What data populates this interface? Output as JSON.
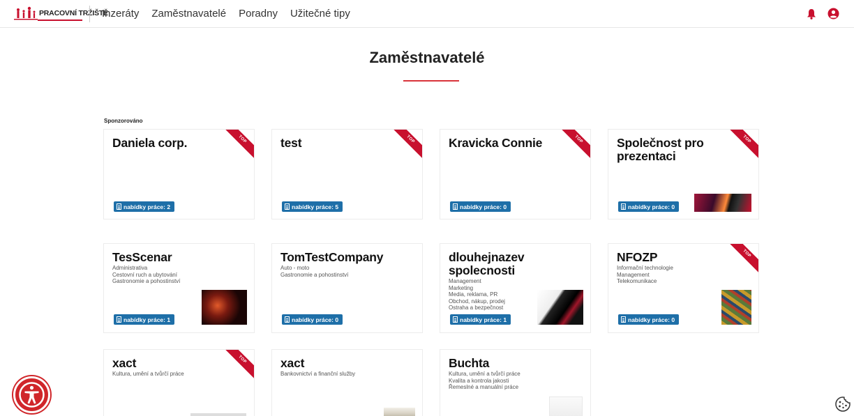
{
  "header": {
    "logo_text": "PRACOVNÍ TRŽIŠTĚ",
    "nav": [
      "Inzeráty",
      "Zaměstnavatelé",
      "Poradny",
      "Užitečné tipy"
    ],
    "icons": [
      "bell-icon",
      "user-circle-icon"
    ],
    "accent_color": "#c8102e"
  },
  "page": {
    "title": "Zaměstnavatelé",
    "sponsored_label": "Sponzorováno"
  },
  "cards": [
    {
      "name": "Daniela corp.",
      "categories": [],
      "jobs": "nabídky práce: 2",
      "top": "TOP"
    },
    {
      "name": "test",
      "categories": [],
      "jobs": "nabídky práce: 5",
      "top": "TOP"
    },
    {
      "name": "Kravicka Connie",
      "categories": [],
      "jobs": "nabídky práce: 0",
      "top": "TOP"
    },
    {
      "name": "Společnost pro prezentaci",
      "categories": [],
      "jobs": "nabídky práce: 0",
      "top": "TOP"
    },
    {
      "name": "TesScenar",
      "categories": [
        "Administrativa",
        "Cestovní ruch a ubytování",
        "Gastronomie a pohostinství"
      ],
      "jobs": "nabídky práce: 1"
    },
    {
      "name": "TomTestCompany",
      "categories": [
        "Auto - moto",
        "Gastronomie a pohostinství"
      ],
      "jobs": "nabídky práce: 0"
    },
    {
      "name": "dlouhejnazev spolecnosti",
      "categories": [
        "Management",
        "Marketing",
        "Media, reklama, PR",
        "Obchod, nákup, prodej",
        "Ostraha a bezpečnost"
      ],
      "jobs": "nabídky práce: 1"
    },
    {
      "name": "NFOZP",
      "categories": [
        "Informační technologie",
        "Management",
        "Telekomunikace"
      ],
      "jobs": "nabídky práce: 0",
      "top": "TOP"
    },
    {
      "name": "xact",
      "categories": [
        "Kultura, umění a tvůrčí práce"
      ],
      "top": "TOP"
    },
    {
      "name": "xact",
      "categories": [
        "Bankovnictví a finanční služby"
      ]
    },
    {
      "name": "Buchta",
      "categories": [
        "Kultura, umění a tvůrčí práce",
        "Kvalita a kontrola jakosti",
        "Řemeslné a manuální práce"
      ]
    }
  ]
}
